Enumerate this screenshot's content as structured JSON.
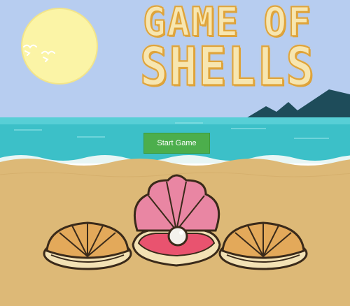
{
  "game": {
    "title_line_1": "GAME OF",
    "title_line_2": "SHELLS",
    "start_label": "Start Game"
  },
  "colors": {
    "sky": "#b7cdf0",
    "sun": "#fbf4a6",
    "sea": "#3cc0c8",
    "sand": "#ddb977",
    "mountain": "#1e4c5a",
    "start_button": "#4cae4c",
    "pink_shell": "#e986a3",
    "orange_shell": "#e3a95a",
    "pearl": "#f4f1ec"
  },
  "icons": [
    "sun-icon",
    "seagull-icon",
    "mountain-icon",
    "shell-icon",
    "pearl-icon"
  ]
}
